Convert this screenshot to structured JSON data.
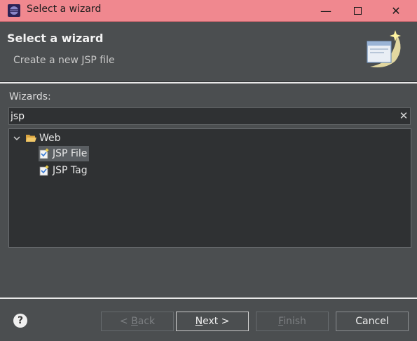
{
  "window": {
    "title": "Select a wizard",
    "controls": {
      "minimize": "—",
      "close": "✕"
    }
  },
  "header": {
    "title": "Select a wizard",
    "description": "Create a new JSP file"
  },
  "wizards": {
    "label": "Wizards:",
    "filter_value": "jsp",
    "clear_icon": "✕",
    "tree": [
      {
        "label": "Web",
        "expanded": true,
        "icon": "folder-open-icon"
      },
      {
        "label": "JSP File",
        "selected": true,
        "icon": "jsp-file-wizard-icon"
      },
      {
        "label": "JSP Tag",
        "selected": false,
        "icon": "jsp-tag-wizard-icon"
      }
    ]
  },
  "footer": {
    "help": "?",
    "back_prefix": "< ",
    "back_mnemonic": "B",
    "back_rest": "ack",
    "next_label": "Next >",
    "finish_label": "Finish",
    "cancel_label": "Cancel"
  },
  "colors": {
    "titlebar": "#f0888f",
    "dialog_bg": "#4b4e50",
    "tree_bg": "#2f3133",
    "selection": "#5a5e62"
  }
}
